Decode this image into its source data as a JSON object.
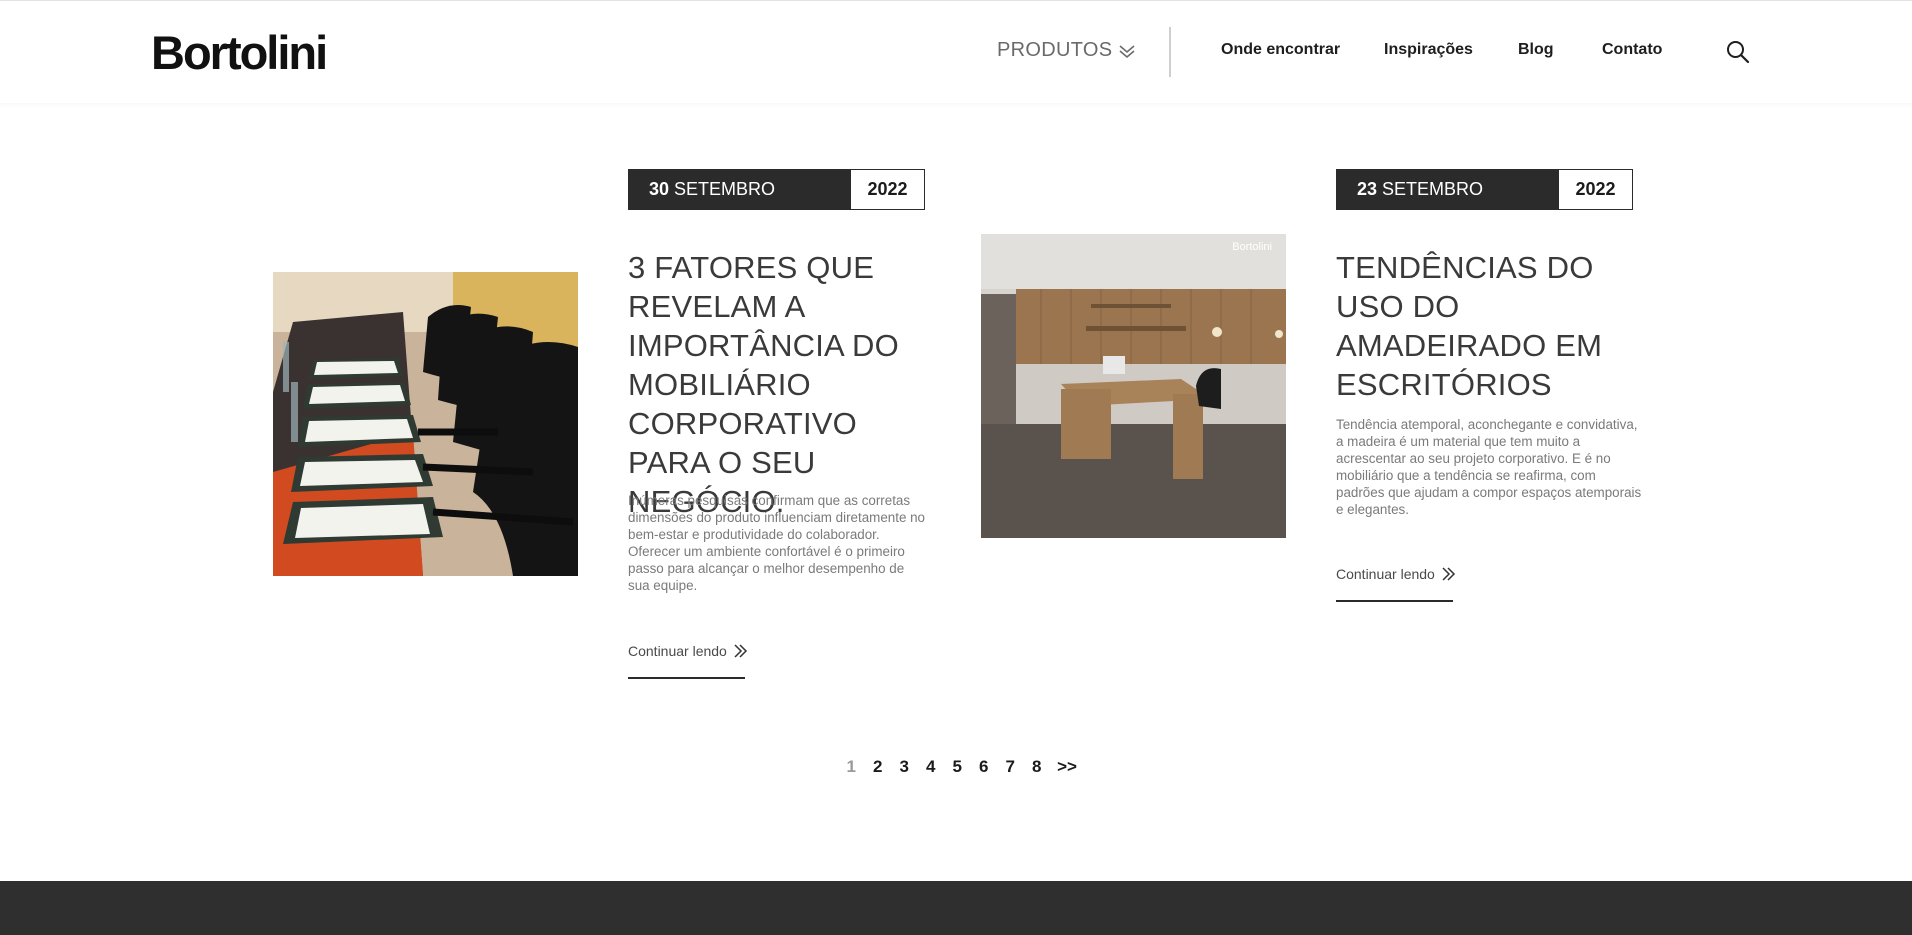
{
  "header": {
    "logo": "Bortolini",
    "products_label": "PRODUTOS",
    "nav": [
      "Onde encontrar",
      "Inspirações",
      "Blog",
      "Contato"
    ]
  },
  "posts": [
    {
      "day": "30",
      "month": "SETEMBRO",
      "year": "2022",
      "title": "3 FATORES QUE REVELAM A IMPORTÂNCIA DO MOBILIÁRIO CORPORATIVO PARA O SEU NEGÓCIO.",
      "excerpt": "Inúmeras pesquisas confirmam que as corretas dimensões do produto influenciam diretamente no bem-estar e produtividade do colaborador. Oferecer um ambiente confortável é o primeiro passo para alcançar o melhor desempenho de sua equipe.",
      "read_more": "Continuar lendo"
    },
    {
      "day": "23",
      "month": "SETEMBRO",
      "year": "2022",
      "title": "TENDÊNCIAS DO USO DO AMADEIRADO EM ESCRITÓRIOS",
      "excerpt": "Tendência atemporal, aconchegante e convidativa, a madeira é um material que tem muito a acrescentar ao seu projeto corporativo. E é no mobiliário que a tendência se reafirma, com padrões que ajudam a compor espaços atemporais e elegantes.",
      "read_more": "Continuar lendo",
      "image_watermark": "Bortolini"
    }
  ],
  "pagination": {
    "pages": [
      "1",
      "2",
      "3",
      "4",
      "5",
      "6",
      "7",
      "8"
    ],
    "next": ">>",
    "current": "1"
  }
}
